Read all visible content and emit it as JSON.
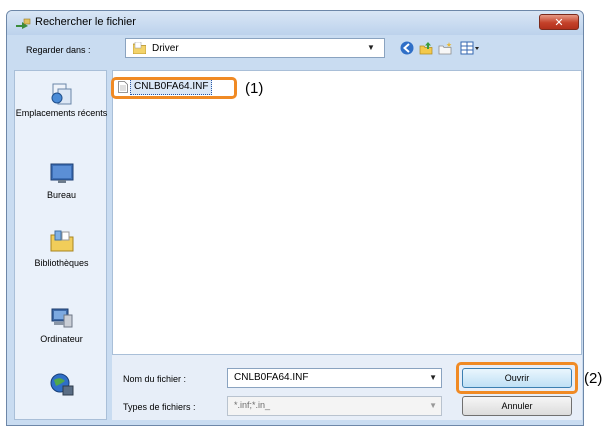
{
  "window": {
    "title": "Rechercher le fichier",
    "close_label": "✕"
  },
  "lookin": {
    "label": "Regarder dans :",
    "value": "Driver"
  },
  "toolbar": {
    "icons": [
      "back-icon",
      "up-folder-icon",
      "new-folder-icon",
      "view-menu-icon"
    ]
  },
  "places": [
    {
      "label": "Emplacements récents",
      "icon": "recent-places-icon"
    },
    {
      "label": "Bureau",
      "icon": "desktop-icon"
    },
    {
      "label": "Bibliothèques",
      "icon": "libraries-icon"
    },
    {
      "label": "Ordinateur",
      "icon": "computer-icon"
    },
    {
      "label": "",
      "icon": "network-icon"
    }
  ],
  "files": [
    {
      "name": "CNLB0FA64.INF",
      "icon": "inf-file-icon"
    }
  ],
  "filename": {
    "label": "Nom du fichier :",
    "value": "CNLB0FA64.INF"
  },
  "filetype": {
    "label": "Types de fichiers :",
    "value": "*.inf;*.in_"
  },
  "buttons": {
    "open": "Ouvrir",
    "cancel": "Annuler"
  },
  "callouts": {
    "file": "(1)",
    "open": "(2)"
  },
  "colors": {
    "callout": "#f08a24",
    "window_frame": "#c9dcf1",
    "close_button": "#c4412a"
  }
}
